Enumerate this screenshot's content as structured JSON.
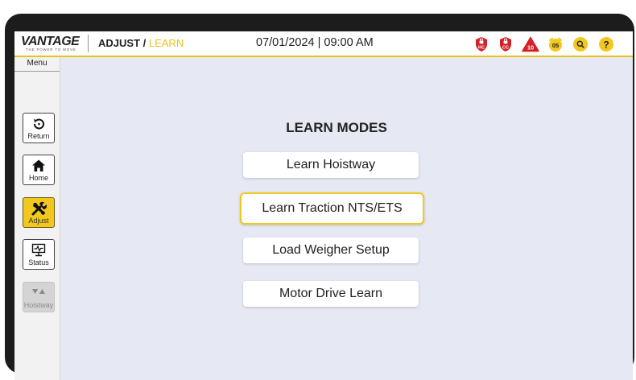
{
  "header": {
    "logo_text": "VANTAGE",
    "logo_tagline": "THE POWER TO MOVE",
    "breadcrumb_parent": "ADJUST",
    "breadcrumb_sep": " / ",
    "breadcrumb_current": "LEARN",
    "datetime": "07/01/2024 | 09:00 AM",
    "status": {
      "hc_label": "HC",
      "cc_label": "CC",
      "alarm_count": "10",
      "alarm_clock_count": "05",
      "alarm_color": "#d61f26",
      "accent_color": "#f2c81e"
    }
  },
  "sidebar": {
    "menu_label": "Menu",
    "items": [
      {
        "label": "Return",
        "icon": "return-icon"
      },
      {
        "label": "Home",
        "icon": "home-icon"
      },
      {
        "label": "Adjust",
        "icon": "tools-icon",
        "active": true
      },
      {
        "label": "Status",
        "icon": "monitor-icon"
      },
      {
        "label": "Hoistway",
        "icon": "up-down-arrows-icon",
        "disabled": true
      }
    ]
  },
  "main": {
    "title": "LEARN MODES",
    "buttons": [
      {
        "label": "Learn Hoistway"
      },
      {
        "label": "Learn Traction NTS/ETS",
        "selected": true
      },
      {
        "label": "Load Weigher Setup"
      },
      {
        "label": "Motor Drive Learn"
      }
    ]
  }
}
